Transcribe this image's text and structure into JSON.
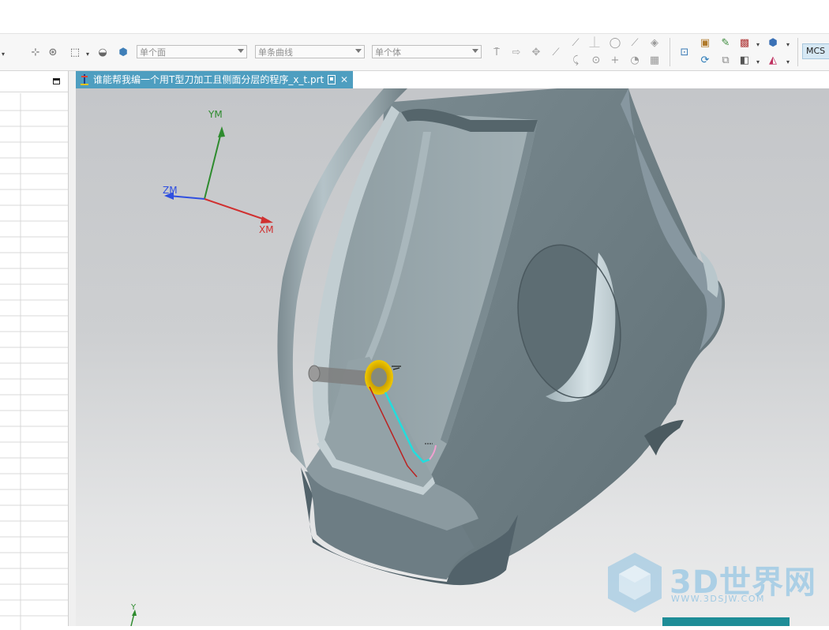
{
  "toolbar": {
    "face_filter": "单个面",
    "curve_filter": "单条曲线",
    "body_filter": "单个体",
    "mcs_label": "MCS"
  },
  "document": {
    "tab_title": "谁能帮我编一个用T型刀加工且侧面分层的程序_x_t.prt"
  },
  "viewport": {
    "axes": {
      "ym": "YM",
      "zm": "ZM",
      "xm": "XM",
      "y": "Y"
    }
  },
  "watermark": {
    "brand": "3D世界网",
    "url": "WWW.3DSJW.COM"
  },
  "colors": {
    "tab_active": "#4e9ec0",
    "axis_x": "#d03030",
    "axis_y": "#2e8b2e",
    "axis_z": "#2f4fe0",
    "tool_highlight": "#e8b400",
    "toolpath": "#22dddd"
  }
}
